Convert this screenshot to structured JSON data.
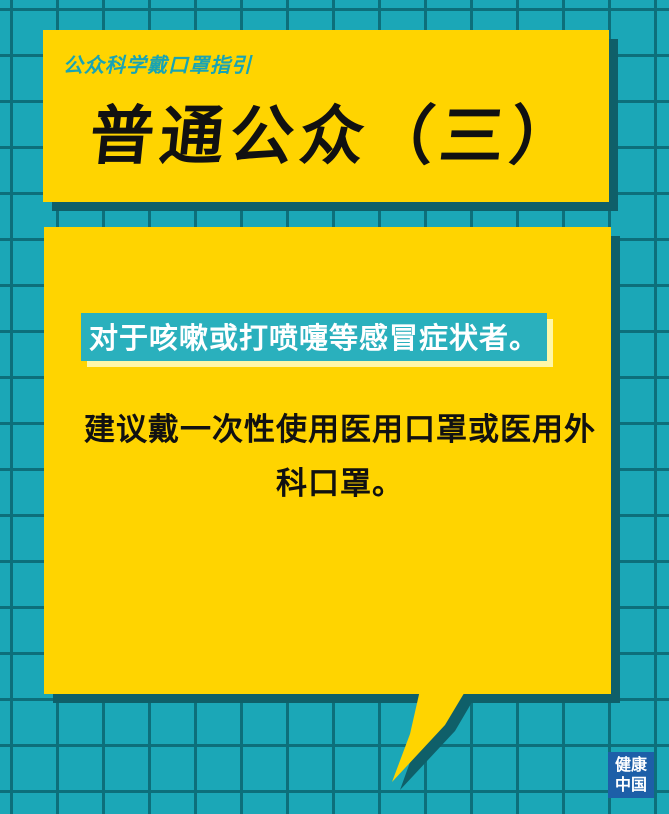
{
  "header": {
    "subtitle": "公众科学戴口罩指引",
    "title": "普通公众（三）"
  },
  "body": {
    "highlight": "对于咳嗽或打喷嚏等感冒症状者。",
    "advice": "建议戴一次性使用医用口罩或医用外科口罩。"
  },
  "logo": {
    "line1": "健康",
    "line2": "中国"
  },
  "colors": {
    "background": "#1ba7b7",
    "grid": "#0d6f7b",
    "card": "#ffd400",
    "shadow": "#0f5f69",
    "highlight": "#2ab0bd",
    "logo": "#1d5fa8"
  }
}
